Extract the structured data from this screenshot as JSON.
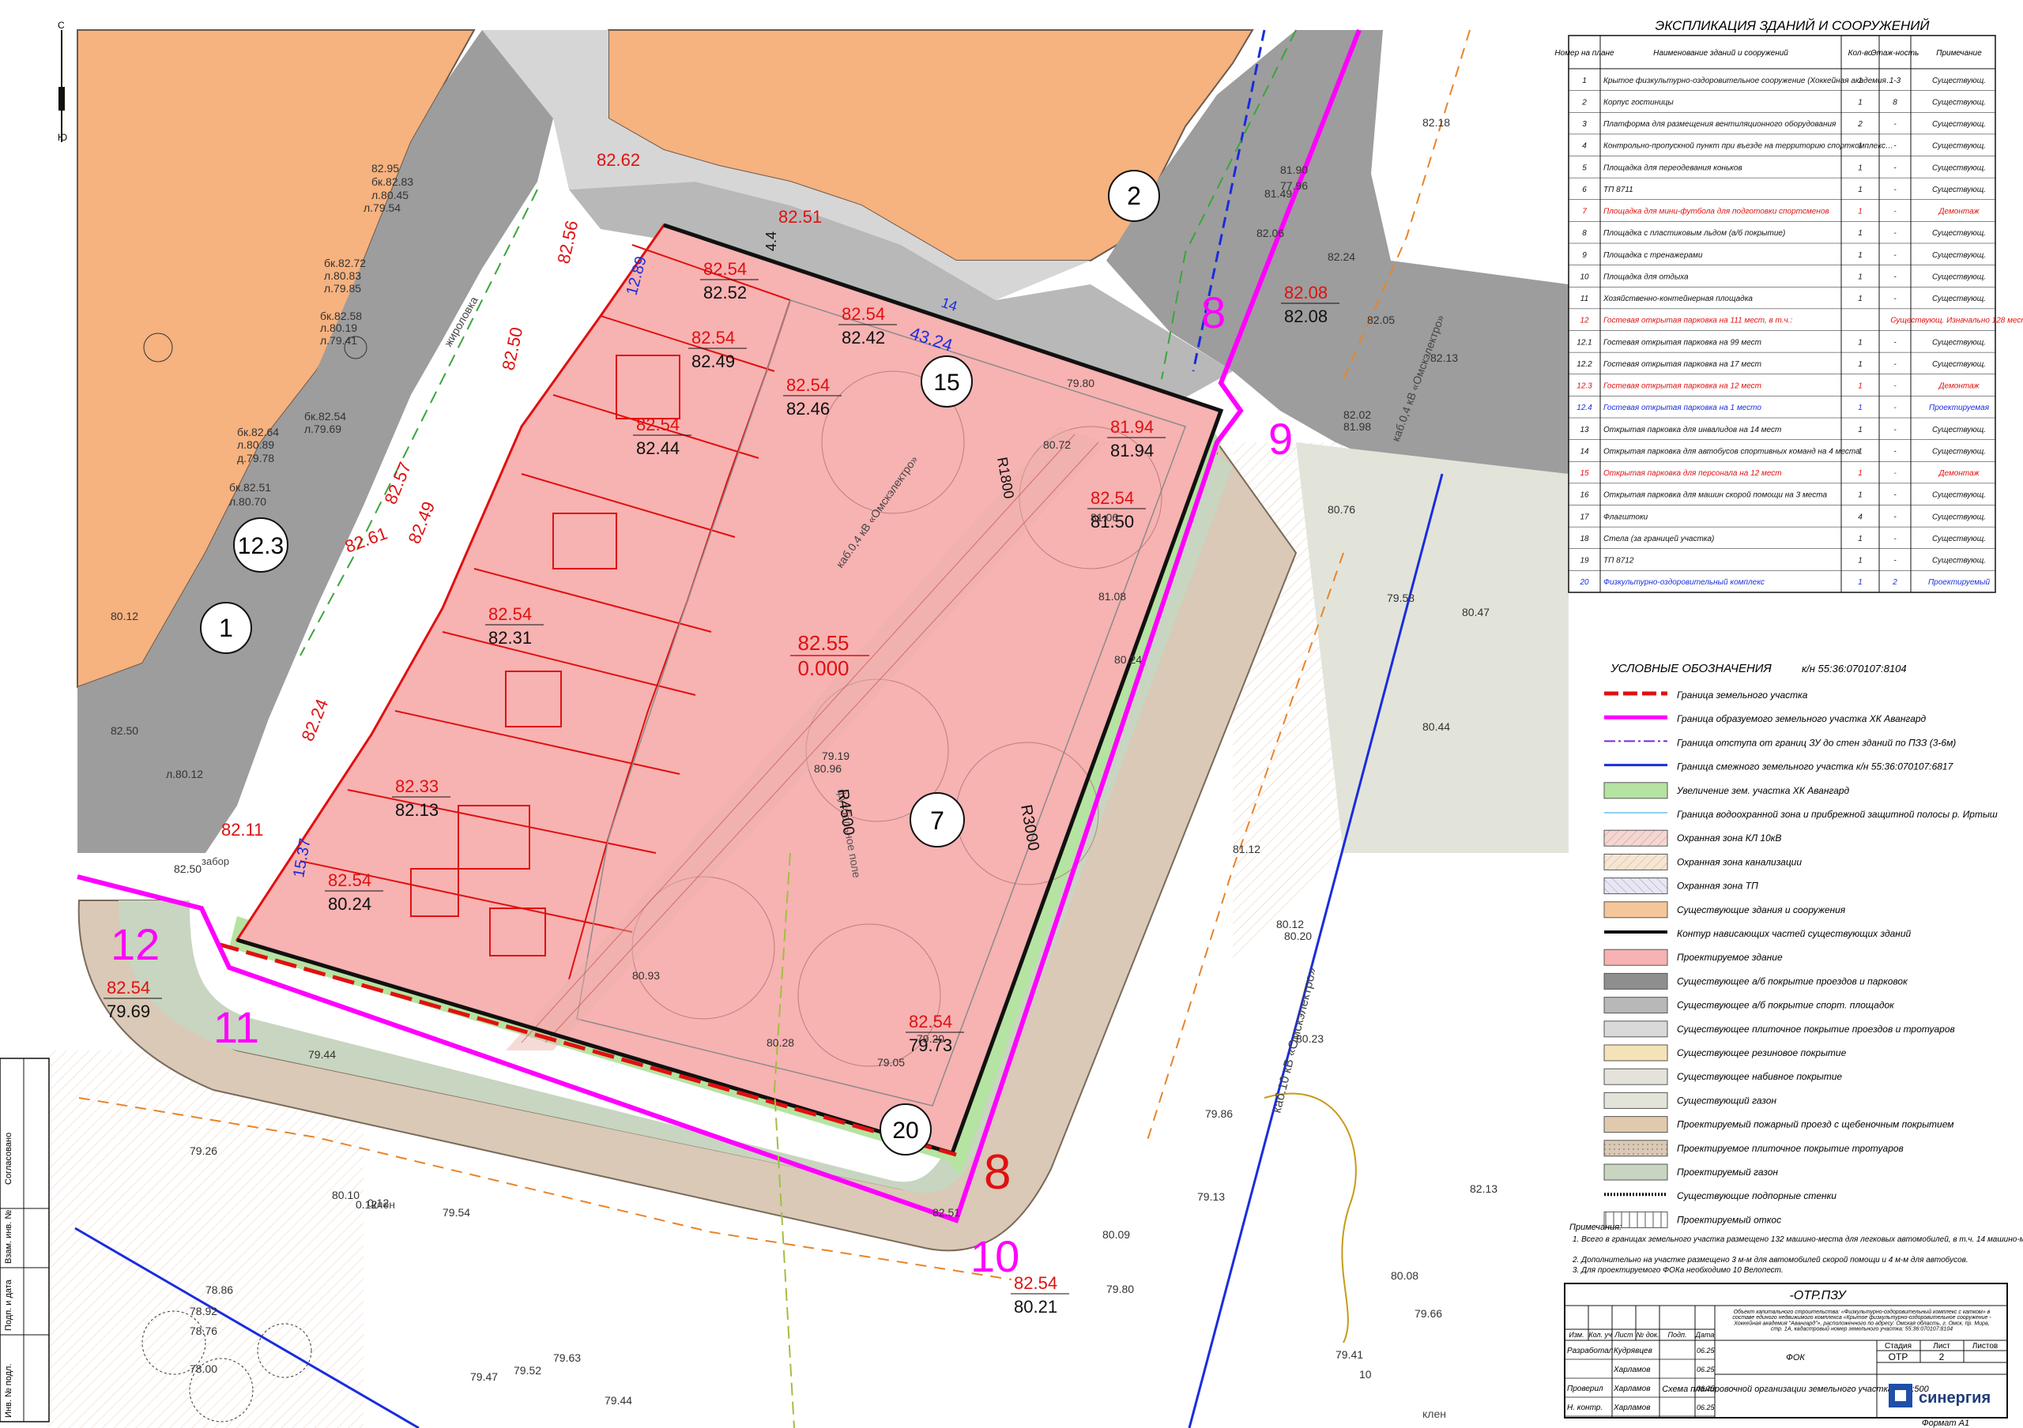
{
  "colors": {
    "existing_building": "#f6b27f",
    "designed_building": "#f7b2b2",
    "asphalt": "#9d9d9d",
    "sport_asphalt": "#b8b8b8",
    "tile": "#d6d6d6",
    "lawn_existing": "#e2e4da",
    "lawn_design": "#c8d5c0",
    "green_extension": "#b5e3a1",
    "paving_design": "#d9c9b6",
    "fire_road": "#e6cfbb",
    "boundary_red": "#e01010",
    "boundary_magenta": "#ff00ff",
    "blue_line": "#1a2ddd"
  },
  "buildings": [
    {
      "number": "1"
    },
    {
      "number": "2"
    },
    {
      "number": "7"
    },
    {
      "number": "12.3"
    },
    {
      "number": "15"
    },
    {
      "number": "20"
    }
  ],
  "point_numbers": [
    "8",
    "9",
    "10",
    "11",
    "12",
    "8"
  ],
  "plan_labels": {
    "center_mark_top": "82.55",
    "center_mark_bottom": "0.000",
    "field_label": "футбольное поле",
    "radius_1": "R1800",
    "radius_2": "R4500",
    "radius_3": "R3000",
    "curb_label": "жиро­ловка",
    "kl_label_1": "каб.0,4 кВ «Омскэлектро»",
    "kl_label_2": "каб.10 кВ «Омскэлектро»",
    "kl_label_3": "каб.0,4 кВ «Омскэлектро»",
    "tree_label": "клен",
    "fence_label": "забор",
    "dim_1": "12.89",
    "dim_2": "43.24",
    "dim_3": "14",
    "dim_4": "15.37",
    "dim_5": "4.4"
  },
  "elevations": [
    {
      "red": "82.62",
      "black": ""
    },
    {
      "red": "82.51",
      "black": ""
    },
    {
      "red": "82.54",
      "black": "82.52"
    },
    {
      "red": "82.54",
      "black": "82.42"
    },
    {
      "red": "82.54",
      "black": "82.49"
    },
    {
      "red": "82.54",
      "black": "82.46"
    },
    {
      "red": "82.54",
      "black": "82.44"
    },
    {
      "red": "81.94",
      "black": "81.94"
    },
    {
      "red": "82.54",
      "black": "81.50"
    },
    {
      "red": "82.08",
      "black": "82.08"
    },
    {
      "red": "82.54",
      "black": "82.31"
    },
    {
      "red": "82.33",
      "black": "82.13"
    },
    {
      "red": "82.54",
      "black": "80.24"
    },
    {
      "red": "82.54",
      "black": "79.73"
    },
    {
      "red": "82.54",
      "black": "79.69"
    },
    {
      "red": "82.54",
      "black": "80.21"
    },
    {
      "red": "82.11",
      "black": ""
    },
    {
      "red": "82.24",
      "black": ""
    },
    {
      "red": "82.49",
      "black": ""
    },
    {
      "red": "82.57",
      "black": ""
    },
    {
      "red": "82.61",
      "black": ""
    },
    {
      "red": "82.50",
      "black": ""
    },
    {
      "red": "82.56",
      "black": ""
    }
  ],
  "survey_marks": [
    "82.95",
    "бк.82.83",
    "л.80.45",
    "л.79.54",
    "бк.82.72",
    "л.80.83",
    "л.79.85",
    "бк.82.58",
    "л.80.19",
    "л.79.41",
    "бк.82.54",
    "л.79.69",
    "бк.82.64",
    "л.80.89",
    "д.79.78",
    "бк.82.51",
    "л.80.70",
    "80.12",
    "82.50",
    "л.80.12",
    "82.50",
    "79.26",
    "79.44",
    "79.54",
    "78.86",
    "78.92",
    "78.76",
    "78.00",
    "79.47",
    "79.52",
    "79.63",
    "79.44",
    "80.10",
    "0.12",
    "80.09",
    "79.13",
    "79.80",
    "80.08",
    "79.66",
    "79.41",
    "79.86",
    "80.20",
    "80.12",
    "80.23",
    "80.44",
    "80.47",
    "80.76",
    "79.58",
    "82.13",
    "82.05",
    "82.18",
    "81.98",
    "82.02",
    "82.24",
    "81.49",
    "77.96",
    "81.90",
    "82.06",
    "79.80",
    "80.72",
    "81.06",
    "81.08",
    "80.24",
    "79.19",
    "80.96",
    "80.93",
    "80.28",
    "79.05",
    "79.20",
    "81.12",
    "82.13",
    "82.51",
    "10",
    "0.12"
  ],
  "explication": {
    "title": "ЭКСПЛИКАЦИЯ ЗДАНИЙ И СООРУЖЕНИЙ",
    "headers": [
      "Номер на плане",
      "Наименование зданий и сооружений",
      "Кол-во",
      "Этаж-ность",
      "Примечание"
    ],
    "rows": [
      {
        "n": "1",
        "name": "Крытое физкультурно-оздоровительное сооружение (Хоккейная академия \"Авангард\")",
        "qty": "1",
        "floors": "1-3",
        "note": "Существующ.",
        "tone": "normal"
      },
      {
        "n": "2",
        "name": "Корпус гостиницы",
        "qty": "1",
        "floors": "8",
        "note": "Существующ.",
        "tone": "normal"
      },
      {
        "n": "3",
        "name": "Платформа для размещения вентиляционного оборудования",
        "qty": "2",
        "floors": "-",
        "note": "Существующ.",
        "tone": "normal"
      },
      {
        "n": "4",
        "name": "Контрольно-пропускной пункт при въезде на территорию спорткомплекса",
        "qty": "1",
        "floors": "-",
        "note": "Существующ.",
        "tone": "normal"
      },
      {
        "n": "5",
        "name": "Площадка для переодевания коньков",
        "qty": "1",
        "floors": "-",
        "note": "Существующ.",
        "tone": "normal"
      },
      {
        "n": "6",
        "name": "ТП 8711",
        "qty": "1",
        "floors": "-",
        "note": "Существующ.",
        "tone": "normal"
      },
      {
        "n": "7",
        "name": "Площадка для мини-футбола для подготовки спортсменов",
        "qty": "1",
        "floors": "-",
        "note": "Демонтаж",
        "tone": "red"
      },
      {
        "n": "8",
        "name": "Площадка с пластиковым льдом (а/б покрытие)",
        "qty": "1",
        "floors": "-",
        "note": "Существующ.",
        "tone": "normal"
      },
      {
        "n": "9",
        "name": "Площадка с тренажерами",
        "qty": "1",
        "floors": "-",
        "note": "Существующ.",
        "tone": "normal"
      },
      {
        "n": "10",
        "name": "Площадка для отдыха",
        "qty": "1",
        "floors": "-",
        "note": "Существующ.",
        "tone": "normal"
      },
      {
        "n": "11",
        "name": "Хозяйственно-контейнерная площадка",
        "qty": "1",
        "floors": "-",
        "note": "Существующ.",
        "tone": "normal"
      },
      {
        "n": "12",
        "name": "Гостевая открытая парковка на 111 мест, в т.ч.:",
        "qty": "",
        "floors": "-",
        "note": "Существующ. Изначально 128 мест",
        "tone": "red"
      },
      {
        "n": "12.1",
        "name": "Гостевая открытая парковка на 99 мест",
        "qty": "1",
        "floors": "-",
        "note": "Существующ.",
        "tone": "normal"
      },
      {
        "n": "12.2",
        "name": "Гостевая открытая парковка на 17 мест",
        "qty": "1",
        "floors": "-",
        "note": "Существующ.",
        "tone": "normal"
      },
      {
        "n": "12.3",
        "name": "Гостевая открытая парковка на 12 мест",
        "qty": "1",
        "floors": "-",
        "note": "Демонтаж",
        "tone": "red"
      },
      {
        "n": "12.4",
        "name": "Гостевая открытая парковка на 1 место",
        "qty": "1",
        "floors": "-",
        "note": "Проектируемая",
        "tone": "blue"
      },
      {
        "n": "13",
        "name": "Открытая парковка для инвалидов на 14 мест",
        "qty": "1",
        "floors": "-",
        "note": "Существующ.",
        "tone": "normal"
      },
      {
        "n": "14",
        "name": "Открытая парковка для автобусов спортивных команд на 4 места",
        "qty": "1",
        "floors": "-",
        "note": "Существующ.",
        "tone": "normal"
      },
      {
        "n": "15",
        "name": "Открытая парковка для персонала на 12 мест",
        "qty": "1",
        "floors": "-",
        "note": "Демонтаж",
        "tone": "red"
      },
      {
        "n": "16",
        "name": "Открытая парковка для машин скорой помощи на 3 места",
        "qty": "1",
        "floors": "-",
        "note": "Существующ.",
        "tone": "normal"
      },
      {
        "n": "17",
        "name": "Флагштоки",
        "qty": "4",
        "floors": "-",
        "note": "Существующ.",
        "tone": "normal"
      },
      {
        "n": "18",
        "name": "Стела (за границей участка)",
        "qty": "1",
        "floors": "-",
        "note": "Существующ.",
        "tone": "normal"
      },
      {
        "n": "19",
        "name": "ТП 8712",
        "qty": "1",
        "floors": "-",
        "note": "Существующ.",
        "tone": "normal"
      },
      {
        "n": "20",
        "name": "Физкультурно-оздоровительный комплекс",
        "qty": "1",
        "floors": "2",
        "note": "Проектируемый",
        "tone": "blue"
      }
    ]
  },
  "legend": {
    "title": "УСЛОВНЫЕ ОБОЗНАЧЕНИЯ",
    "cadastral": "к/н 55:36:070107:8104",
    "items": [
      {
        "label": "Граница земельного участка",
        "kind": "line",
        "style": "red-dash",
        "color": "#e01010"
      },
      {
        "label": "Граница образуемого земельного участка ХК Авангард",
        "kind": "line",
        "style": "magenta",
        "color": "#ff00ff"
      },
      {
        "label": "Граница отступа от границ ЗУ до стен зданий по ПЗЗ (3-6м)",
        "kind": "line",
        "style": "purple-dashdot",
        "color": "#7a2ad6"
      },
      {
        "label": "Граница смежного земельного участка к/н 55:36:070107:6817",
        "kind": "line",
        "style": "blue",
        "color": "#1a2ddd"
      },
      {
        "label": "Увеличение зем. участка ХК Авангард",
        "kind": "box",
        "style": "solid",
        "color": "#b5e3a1"
      },
      {
        "label": "Граница водоохранной зона и прибрежной защитной полосы р. Иртыш",
        "kind": "line",
        "style": "lightblue",
        "color": "#8fcff2"
      },
      {
        "label": "Охранная зона КЛ 10кВ",
        "kind": "box",
        "style": "hatch-red",
        "color": "#f3d7d2"
      },
      {
        "label": "Охранная зона канализации",
        "kind": "box",
        "style": "hatch-brown",
        "color": "#f5e6d3"
      },
      {
        "label": "Охранная зона ТП",
        "kind": "box",
        "style": "hatch-blue",
        "color": "#e9e6f3"
      },
      {
        "label": "Существующие здания и сооружения",
        "kind": "box",
        "style": "solid",
        "color": "#f6c69b"
      },
      {
        "label": "Контур нависающих частей существующих зданий",
        "kind": "line",
        "style": "black-thick",
        "color": "#111111"
      },
      {
        "label": "Проектируемое здание",
        "kind": "box",
        "style": "solid",
        "color": "#f7b2b2"
      },
      {
        "label": "Существующее а/б покрытие проездов и парковок",
        "kind": "box",
        "style": "solid",
        "color": "#8e8e8e"
      },
      {
        "label": "Существующее а/б покрытие спорт. площадок",
        "kind": "box",
        "style": "solid",
        "color": "#b8b8b8"
      },
      {
        "label": "Существующее плиточное покрытие проездов и тротуаров",
        "kind": "box",
        "style": "solid",
        "color": "#d9d9d9"
      },
      {
        "label": "Существующее резиновое покрытие",
        "kind": "box",
        "style": "solid",
        "color": "#f5e3b8"
      },
      {
        "label": "Существующее набивное покрытие",
        "kind": "box",
        "style": "solid",
        "color": "#e4e2da"
      },
      {
        "label": "Существующий газон",
        "kind": "box",
        "style": "solid",
        "color": "#e2e4da"
      },
      {
        "label": "Проектируемый пожарный проезд с щебеночным покрытием",
        "kind": "box",
        "style": "solid",
        "color": "#e1c9ae"
      },
      {
        "label": "Проектируемое плиточное покрытие тротуаров",
        "kind": "box",
        "style": "dots",
        "color": "#d9c9b6"
      },
      {
        "label": "Проектируемый газон",
        "kind": "box",
        "style": "solid",
        "color": "#c8d5c0"
      },
      {
        "label": "Существующие подпорные стенки",
        "kind": "line",
        "style": "wall",
        "color": "#111111"
      },
      {
        "label": "Проектируемый откос",
        "kind": "box",
        "style": "slope",
        "color": "#ffffff"
      }
    ]
  },
  "notes": {
    "title": "Примечания:",
    "items": [
      "1.  Всего в границах земельного участка размещено 132 машино-места для легковых автомобилей, в т.ч. 14 машино-мест для МГН.",
      "2.  Дополнительно на участке размещено 3 м-м для автомобилей скорой помощи и 4 м-м для автобусов.",
      "3.  Для проектируемого ФОКа необходимо 10 Велопест."
    ]
  },
  "title_block": {
    "code": "-ОТР.ПЗУ",
    "object_text": "Объект капитального строительства: «Физкультурно-оздоровительный комплекс с катком» в составе единого недвижимого комплекса «Крытое физкультурно-оздоровительное сооружение - Хоккейная академия \"Авангард\"», расположенного по адресу: Омская область, г. Омск, пр. Мира, стр. 1А, кадастровый номер земельного участка: 55:36:070107:8104",
    "col_headers": [
      "Изм.",
      "Кол. уч",
      "Лист",
      "№ док.",
      "Подп.",
      "Дата"
    ],
    "rows": [
      {
        "role": "Разработал",
        "name": "Кудрявцев",
        "date": "06.25"
      },
      {
        "role": "",
        "name": "Харламов",
        "date": "06.25"
      },
      {
        "role": "Проверил",
        "name": "Харламов",
        "date": "06.25"
      },
      {
        "role": "Н. контр.",
        "name": "Харламов",
        "date": "06.25"
      }
    ],
    "stage_headers": [
      "Стадия",
      "Лист",
      "Листов"
    ],
    "stage_values": [
      "ОТР",
      "2",
      ""
    ],
    "section": "ФОК",
    "sheet_name": "Схема планировочной организации земельного участка. М 1:500",
    "company": "синергия",
    "format": "Формат А1"
  },
  "left_stamp": [
    "Согласовано",
    "Инв. № подл.",
    "Подп. и дата",
    "Взам. инв. №"
  ],
  "north_marks": [
    "С",
    "Ю"
  ]
}
